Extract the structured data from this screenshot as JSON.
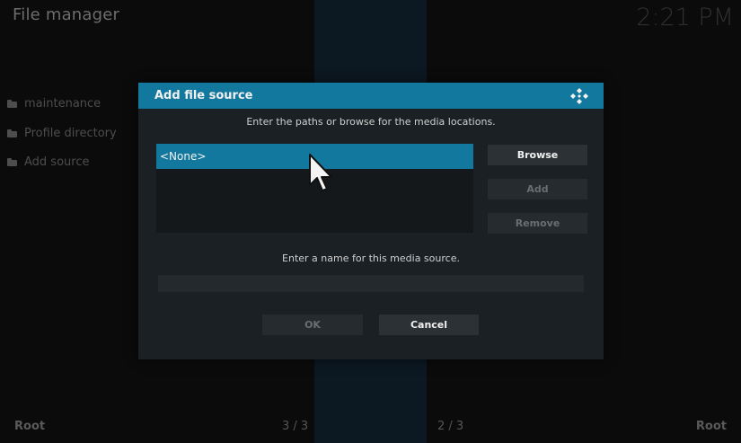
{
  "app": {
    "title": "File manager",
    "clock": "2:21 PM"
  },
  "sidebar": {
    "items": [
      {
        "label": "maintenance"
      },
      {
        "label": "Profile directory"
      },
      {
        "label": "Add source"
      }
    ]
  },
  "footer": {
    "left_label": "Root",
    "left_count": "3 / 3",
    "right_count": "2 / 3",
    "right_label": "Root"
  },
  "dialog": {
    "title": "Add file source",
    "paths_instruction": "Enter the paths or browse for the media locations.",
    "paths_list": [
      "<None>"
    ],
    "browse_label": "Browse",
    "add_label": "Add",
    "remove_label": "Remove",
    "name_instruction": "Enter a name for this media source.",
    "name_value": "",
    "ok_label": "OK",
    "cancel_label": "Cancel"
  },
  "colors": {
    "accent": "#12789e",
    "dialog_bg": "#1b2024"
  }
}
